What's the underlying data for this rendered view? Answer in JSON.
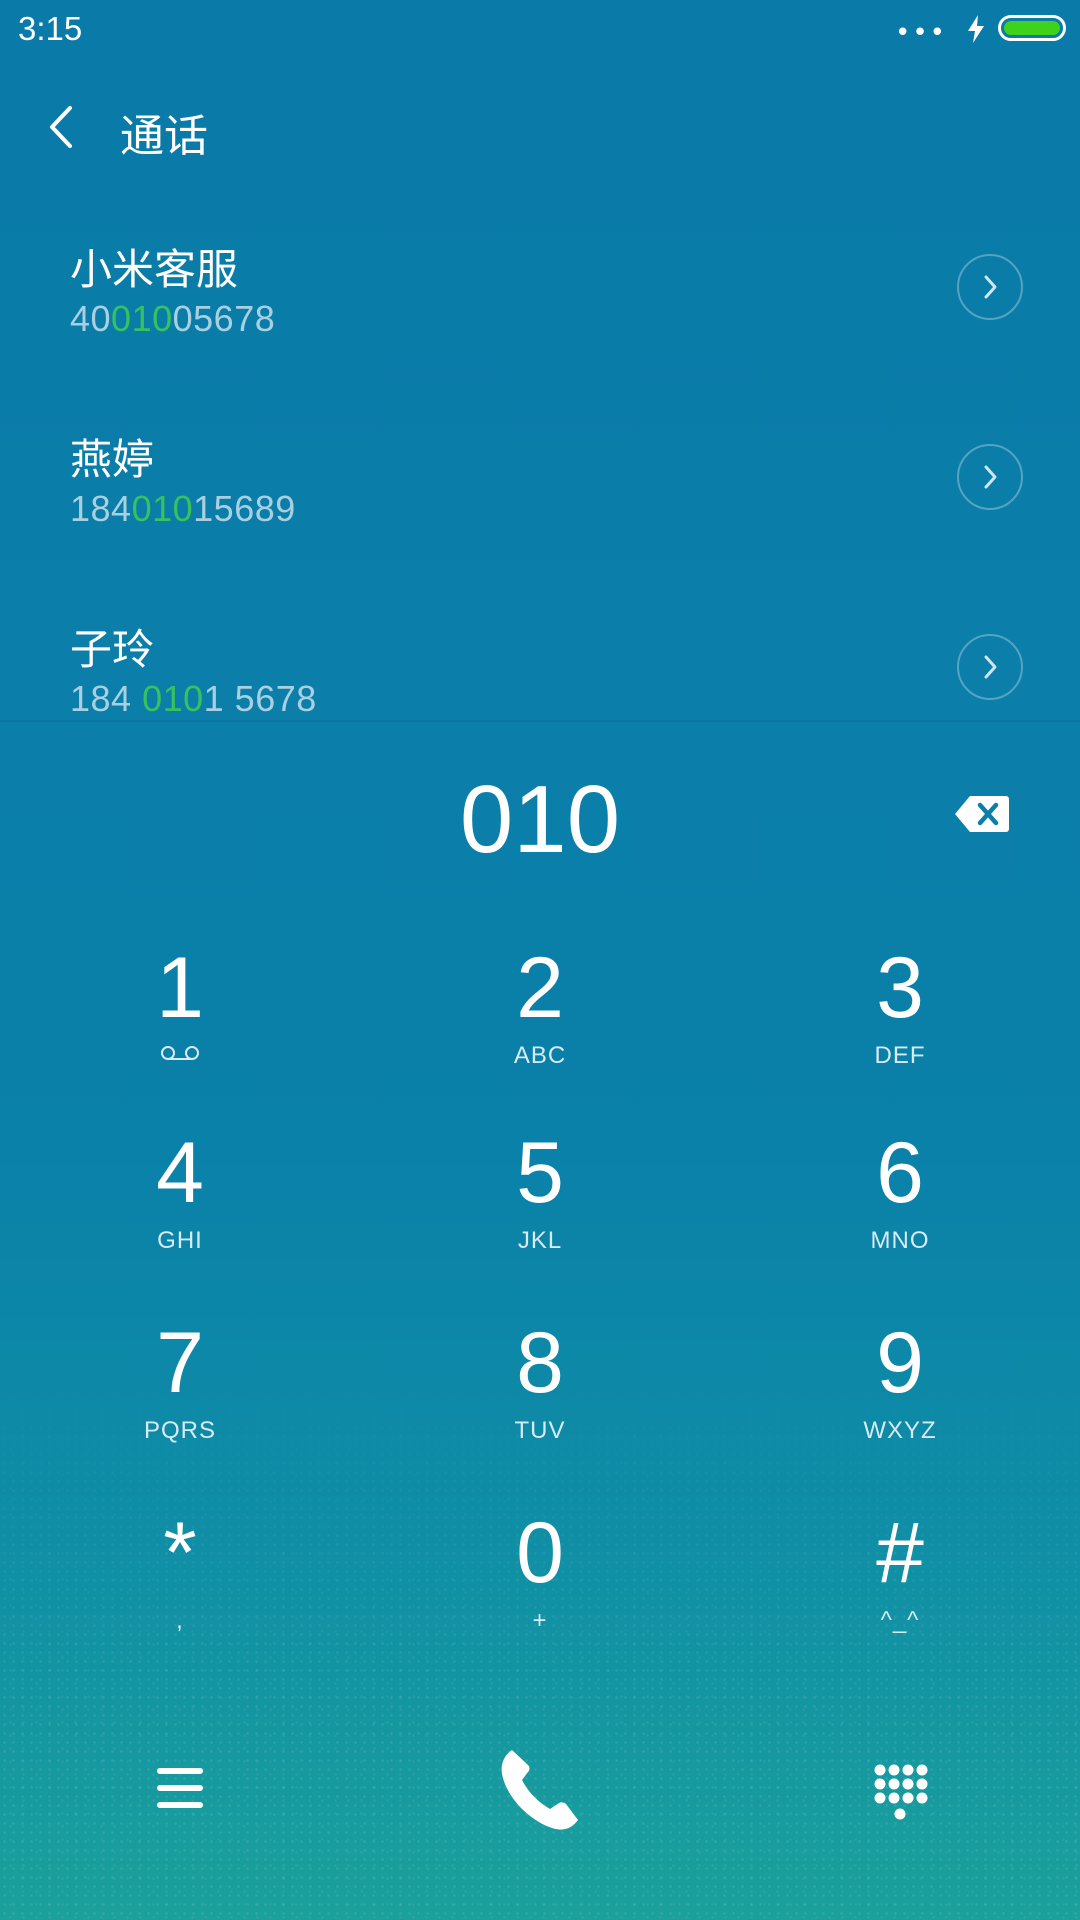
{
  "status_bar": {
    "time": "3:15",
    "more": "•••"
  },
  "header": {
    "title": "通话"
  },
  "contacts": [
    {
      "name": "小米客服",
      "number_parts": [
        "40",
        "010",
        "05678"
      ]
    },
    {
      "name": "燕婷",
      "number_parts": [
        "184",
        "010",
        "15689"
      ]
    },
    {
      "name": "子玲",
      "number_parts": [
        "184 ",
        "010",
        "1 5678"
      ]
    }
  ],
  "dialer": {
    "input": "010"
  },
  "keys": [
    {
      "digit": "1",
      "letters": ""
    },
    {
      "digit": "2",
      "letters": "ABC"
    },
    {
      "digit": "3",
      "letters": "DEF"
    },
    {
      "digit": "4",
      "letters": "GHI"
    },
    {
      "digit": "5",
      "letters": "JKL"
    },
    {
      "digit": "6",
      "letters": "MNO"
    },
    {
      "digit": "7",
      "letters": "PQRS"
    },
    {
      "digit": "8",
      "letters": "TUV"
    },
    {
      "digit": "9",
      "letters": "WXYZ"
    },
    {
      "digit": "*",
      "letters": ","
    },
    {
      "digit": "0",
      "letters": "+"
    },
    {
      "digit": "#",
      "letters": "^_^"
    }
  ],
  "icons": {
    "status": [
      "more-dots-icon",
      "charging-bolt-icon",
      "battery-icon"
    ],
    "header": "back-arrow-icon",
    "contact_action": "chevron-right-icon",
    "delete": "backspace-icon",
    "key1": "voicemail-icon",
    "bottom": [
      "menu-icon",
      "phone-call-icon",
      "dialpad-icon"
    ]
  },
  "colors": {
    "match_highlight": "#37c25f",
    "battery_fill": "#3fd21b"
  }
}
